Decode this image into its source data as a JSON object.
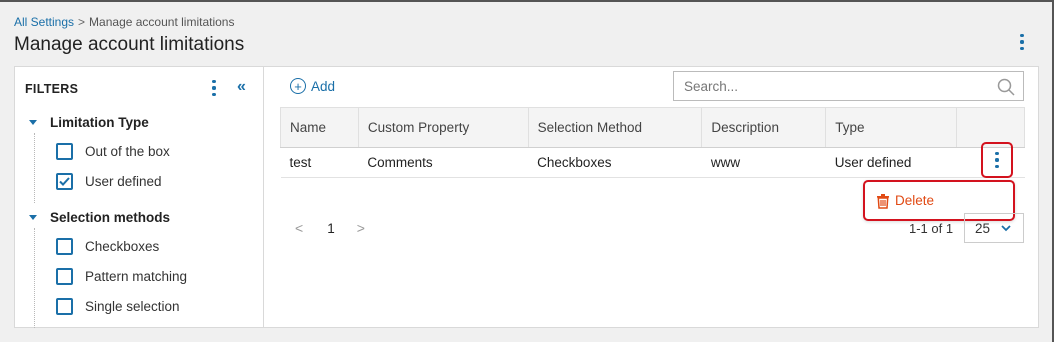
{
  "breadcrumb": {
    "root": "All Settings",
    "separator": ">",
    "current": "Manage account limitations"
  },
  "page": {
    "title": "Manage account limitations"
  },
  "filters": {
    "title": "FILTERS",
    "groups": [
      {
        "label": "Limitation Type",
        "options": [
          {
            "label": "Out of the box",
            "checked": false
          },
          {
            "label": "User defined",
            "checked": true
          }
        ]
      },
      {
        "label": "Selection methods",
        "options": [
          {
            "label": "Checkboxes",
            "checked": false
          },
          {
            "label": "Pattern matching",
            "checked": false
          },
          {
            "label": "Single selection",
            "checked": false
          }
        ]
      }
    ]
  },
  "toolbar": {
    "add_label": "Add",
    "search_placeholder": "Search..."
  },
  "table": {
    "columns": [
      "Name",
      "Custom Property",
      "Selection Method",
      "Description",
      "Type"
    ],
    "rows": [
      {
        "name": "test",
        "custom_property": "Comments",
        "selection_method": "Checkboxes",
        "description": "www",
        "type": "User defined"
      }
    ]
  },
  "row_menu": {
    "delete_label": "Delete"
  },
  "pagination": {
    "prev": "<",
    "page": "1",
    "next": ">",
    "range": "1-1 of 1",
    "per_page": "25"
  },
  "icons": {
    "header_menu": "kebab-vertical-icon",
    "collapse": "double-chevron-left-icon",
    "add": "plus-circle-icon",
    "search": "search-icon",
    "delete": "trash-icon",
    "dropdown": "chevron-down-icon"
  },
  "colors": {
    "accent": "#1a6fa8",
    "danger": "#e14a14",
    "highlight": "#d3121e"
  }
}
